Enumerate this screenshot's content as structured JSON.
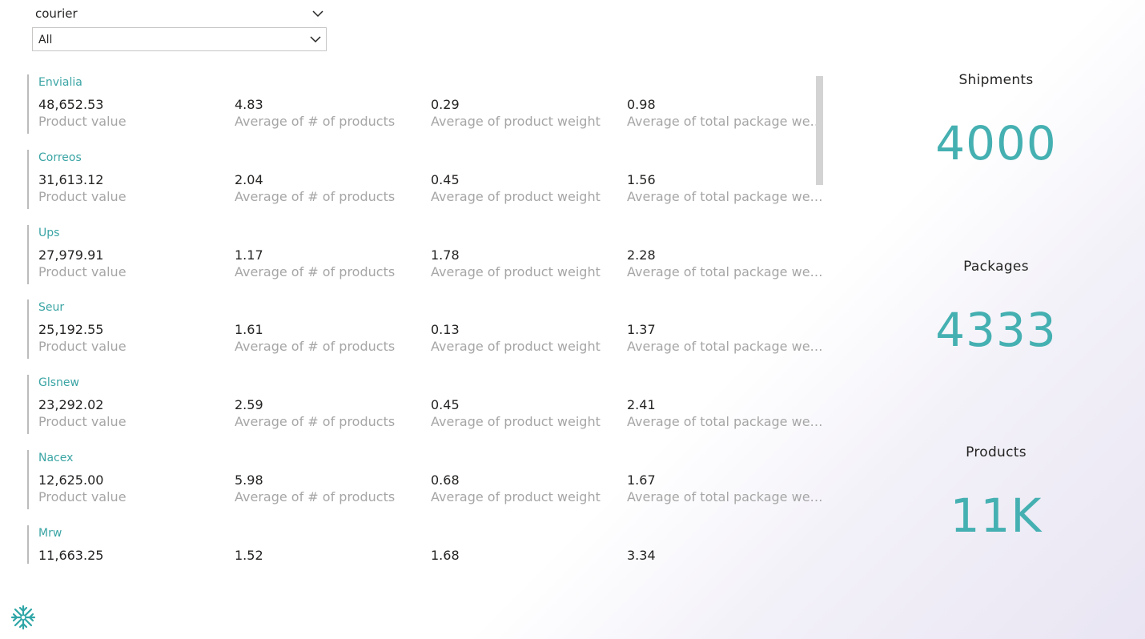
{
  "slicer": {
    "title": "courier",
    "selected": "All"
  },
  "cards": [
    {
      "name": "Envialia",
      "values": [
        "48,652.53",
        "4.83",
        "0.29",
        "0.98"
      ]
    },
    {
      "name": "Correos",
      "values": [
        "31,613.12",
        "2.04",
        "0.45",
        "1.56"
      ]
    },
    {
      "name": "Ups",
      "values": [
        "27,979.91",
        "1.17",
        "1.78",
        "2.28"
      ]
    },
    {
      "name": "Seur",
      "values": [
        "25,192.55",
        "1.61",
        "0.13",
        "1.37"
      ]
    },
    {
      "name": "Glsnew",
      "values": [
        "23,292.02",
        "2.59",
        "0.45",
        "2.41"
      ]
    },
    {
      "name": "Nacex",
      "values": [
        "12,625.00",
        "5.98",
        "0.68",
        "1.67"
      ]
    },
    {
      "name": "Mrw",
      "values": [
        "11,663.25",
        "1.52",
        "1.68",
        "3.34"
      ]
    }
  ],
  "metric_labels": [
    "Product value",
    "Average of # of products",
    "Average of product weight",
    "Average of total package wei..."
  ],
  "kpis": [
    {
      "title": "Shipments",
      "value": "4000"
    },
    {
      "title": "Packages",
      "value": "4333"
    },
    {
      "title": "Products",
      "value": "11K"
    }
  ],
  "colors": {
    "accent": "#45b0b1",
    "card_title": "#3aa4a4",
    "label_gray": "#a6a6a6"
  },
  "icons": {
    "dropdown": "chevron-down-icon",
    "logo": "snowflake-logo-icon"
  }
}
